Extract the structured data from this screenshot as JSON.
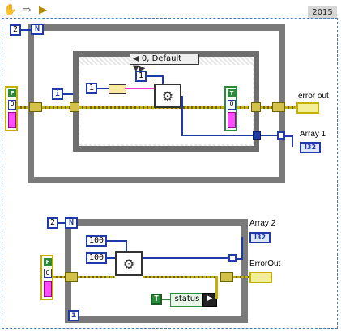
{
  "toolbar": {
    "version_badge": "2015",
    "tools": [
      {
        "name": "hand-tool",
        "glyph": "✋"
      },
      {
        "name": "arrow-tool",
        "glyph": "⇨"
      },
      {
        "name": "run-highlight",
        "glyph": "▶"
      }
    ]
  },
  "top_vi": {
    "n_constant": "2",
    "n_terminal": "N",
    "i_terminal": "i",
    "selector_label": "0, Default",
    "const_shift": "1",
    "const_value": "1",
    "error_in": {
      "status": "F",
      "code": "0"
    },
    "shift_reg": {
      "status": "T",
      "code": "0"
    },
    "indicator_error_label": "error out",
    "indicator_array_label": "Array 1",
    "indicator_array_type": "I32"
  },
  "bottom_vi": {
    "n_constant": "2",
    "n_terminal": "N",
    "i_terminal": "i",
    "const_a": "100",
    "const_b": "100",
    "error_in": {
      "status": "F",
      "code": "0"
    },
    "status_bool": "T",
    "status_label": "status",
    "indicator_array_label": "Array 2",
    "indicator_array_type": "I32",
    "indicator_error_label": "ErrorOut"
  },
  "colors": {
    "frame_dash": "#4a7ab5",
    "int_wire": "#1f39a8",
    "error_wire": "#c4b000",
    "bool_true": "#2a8b3a"
  }
}
